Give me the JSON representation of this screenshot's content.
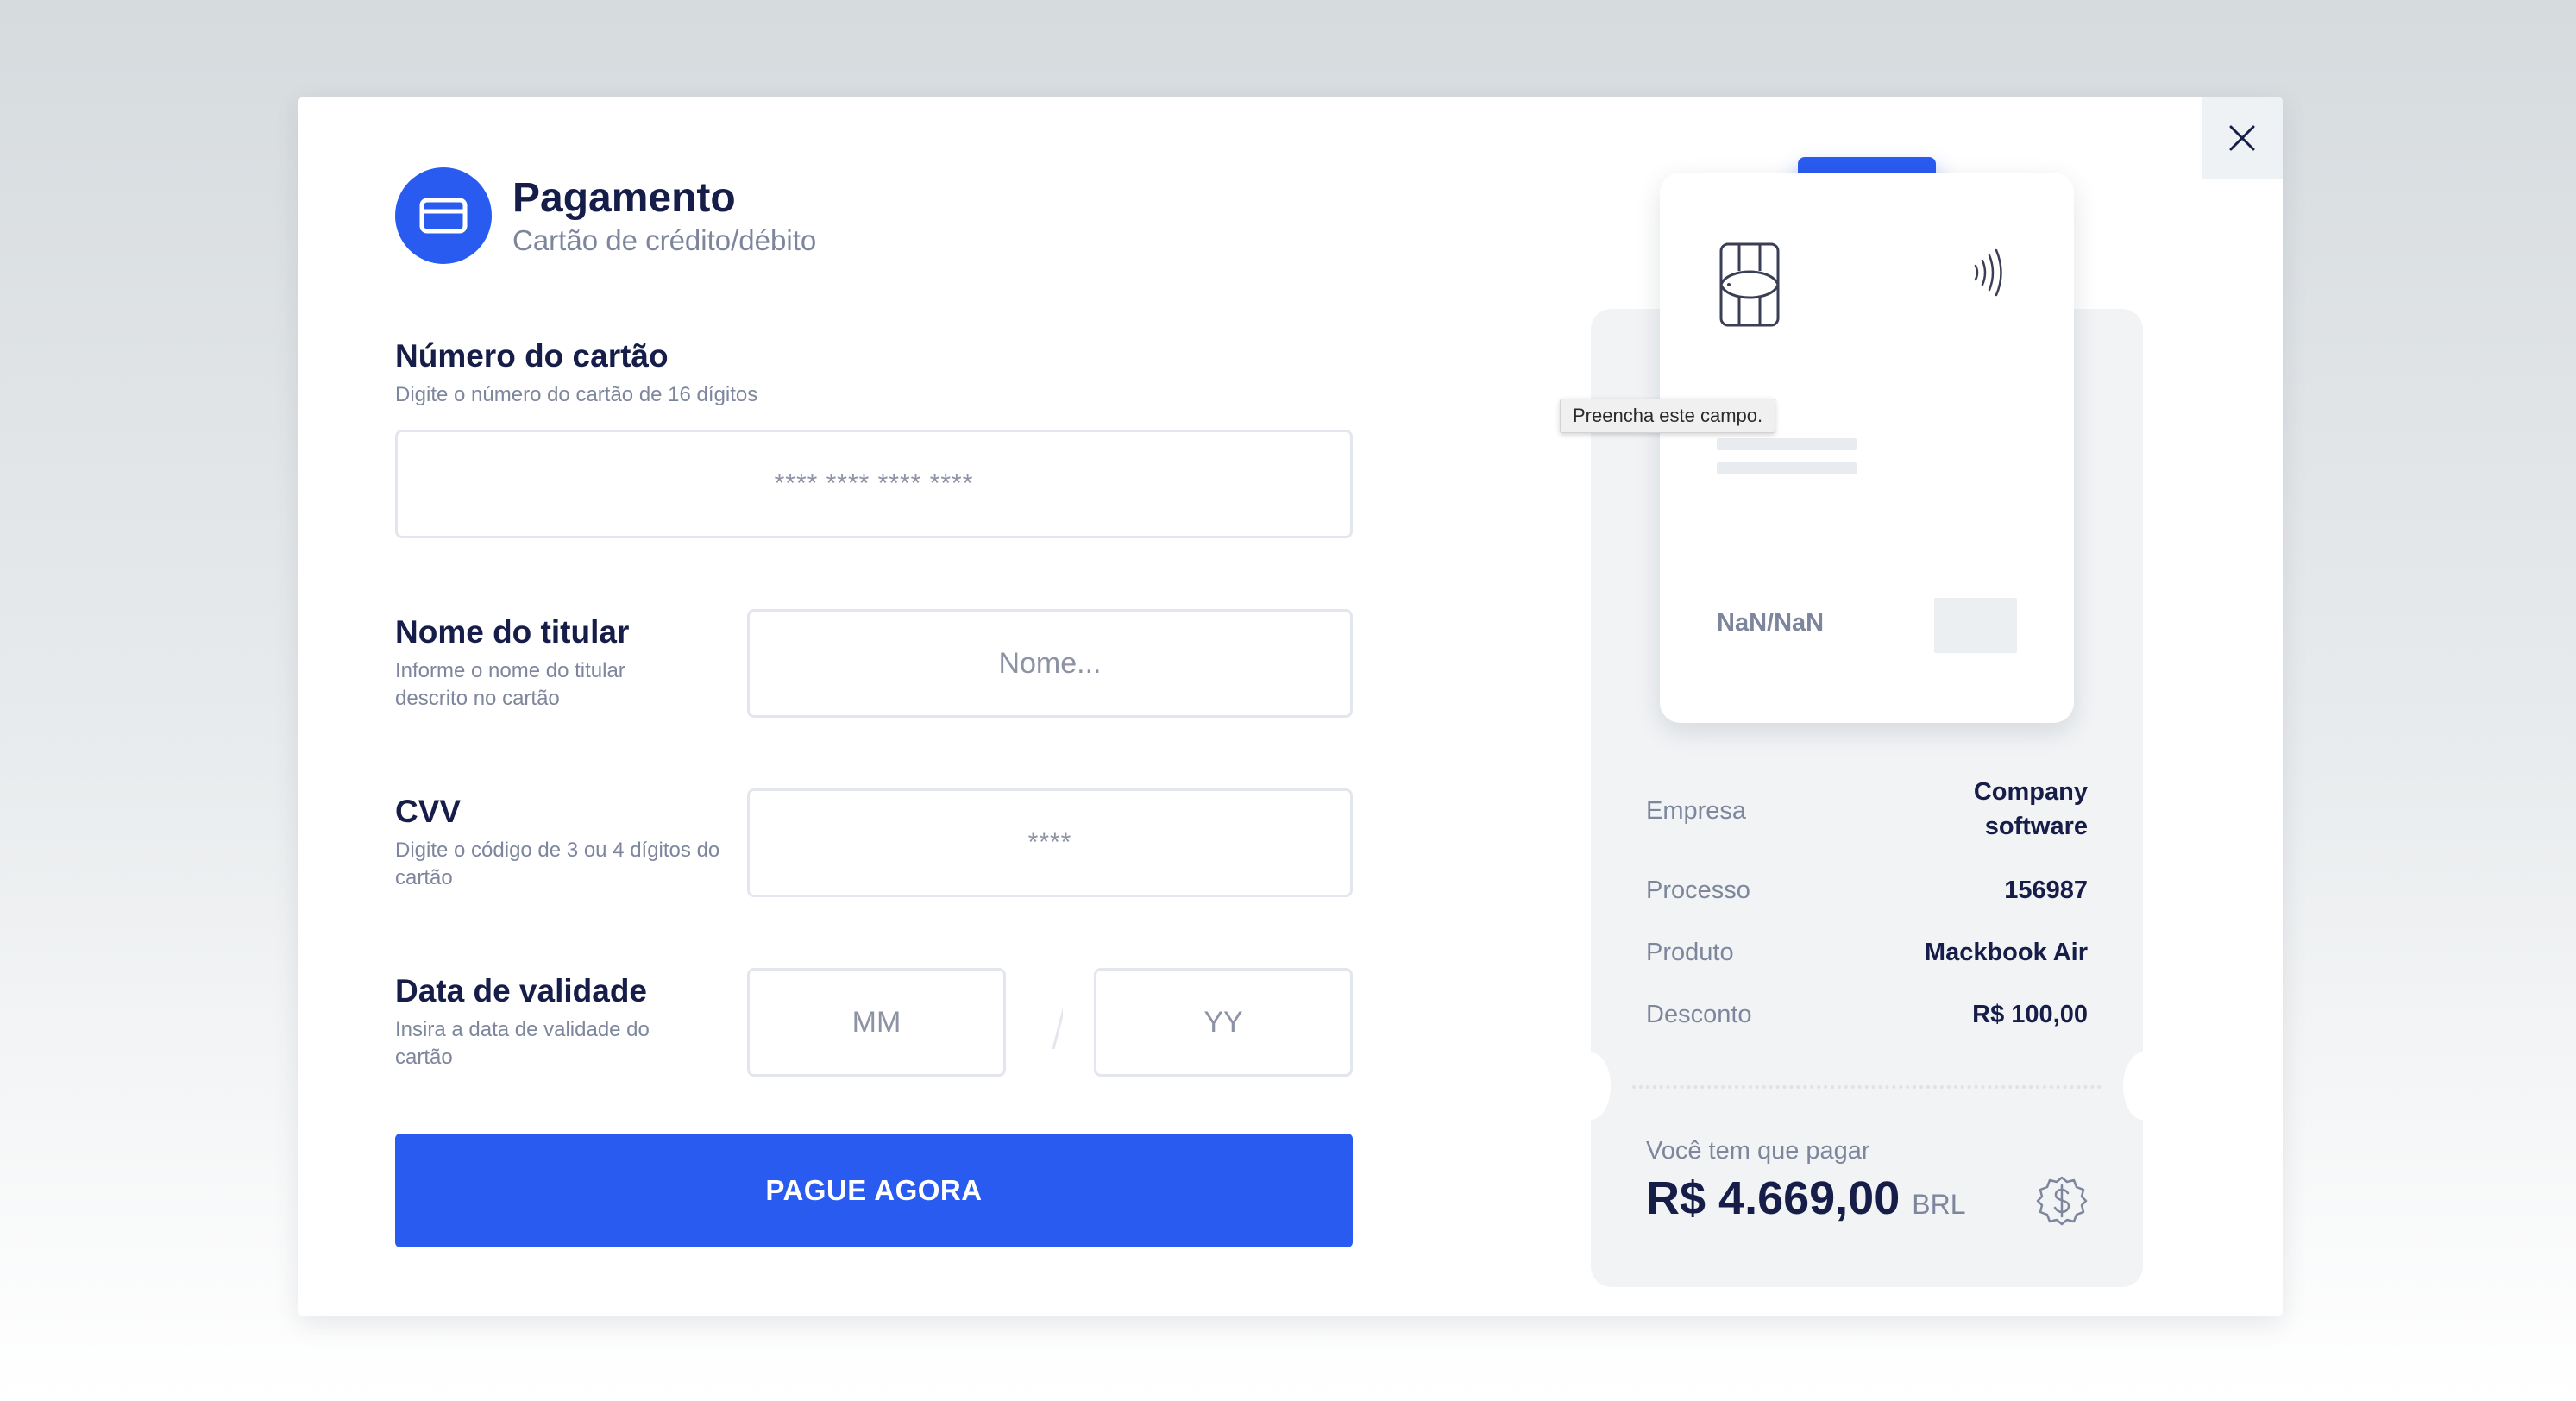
{
  "header": {
    "title": "Pagamento",
    "subtitle": "Cartão de crédito/débito",
    "icon": "credit-card-icon"
  },
  "form": {
    "card_number": {
      "label": "Número do cartão",
      "hint": "Digite o número do cartão de 16 dígitos",
      "placeholder": "**** **** **** ****"
    },
    "holder": {
      "label": "Nome do titular",
      "hint": "Informe o nome do titular descrito no cartão",
      "placeholder": "Nome..."
    },
    "cvv": {
      "label": "CVV",
      "hint": "Digite o código de 3 ou 4 dígitos do cartão",
      "placeholder": "****"
    },
    "expiry": {
      "label": "Data de validade",
      "hint": "Insira a data de validade do cartão",
      "month_placeholder": "MM",
      "year_placeholder": "YY"
    },
    "submit_label": "PAGUE AGORA"
  },
  "tooltip": "Preencha este campo.",
  "card": {
    "expiry_display": "NaN/NaN"
  },
  "summary": {
    "rows": [
      {
        "key": "Empresa",
        "value": "Company software"
      },
      {
        "key": "Processo",
        "value": "156987"
      },
      {
        "key": "Produto",
        "value": "Mackbook Air"
      },
      {
        "key": "Desconto",
        "value": "R$ 100,00"
      }
    ],
    "pay_label": "Você tem que pagar",
    "total": "R$ 4.669,00",
    "currency": "BRL"
  },
  "colors": {
    "accent": "#2a5bf0",
    "text_dark": "#161d48",
    "text_muted": "#7d869c"
  }
}
